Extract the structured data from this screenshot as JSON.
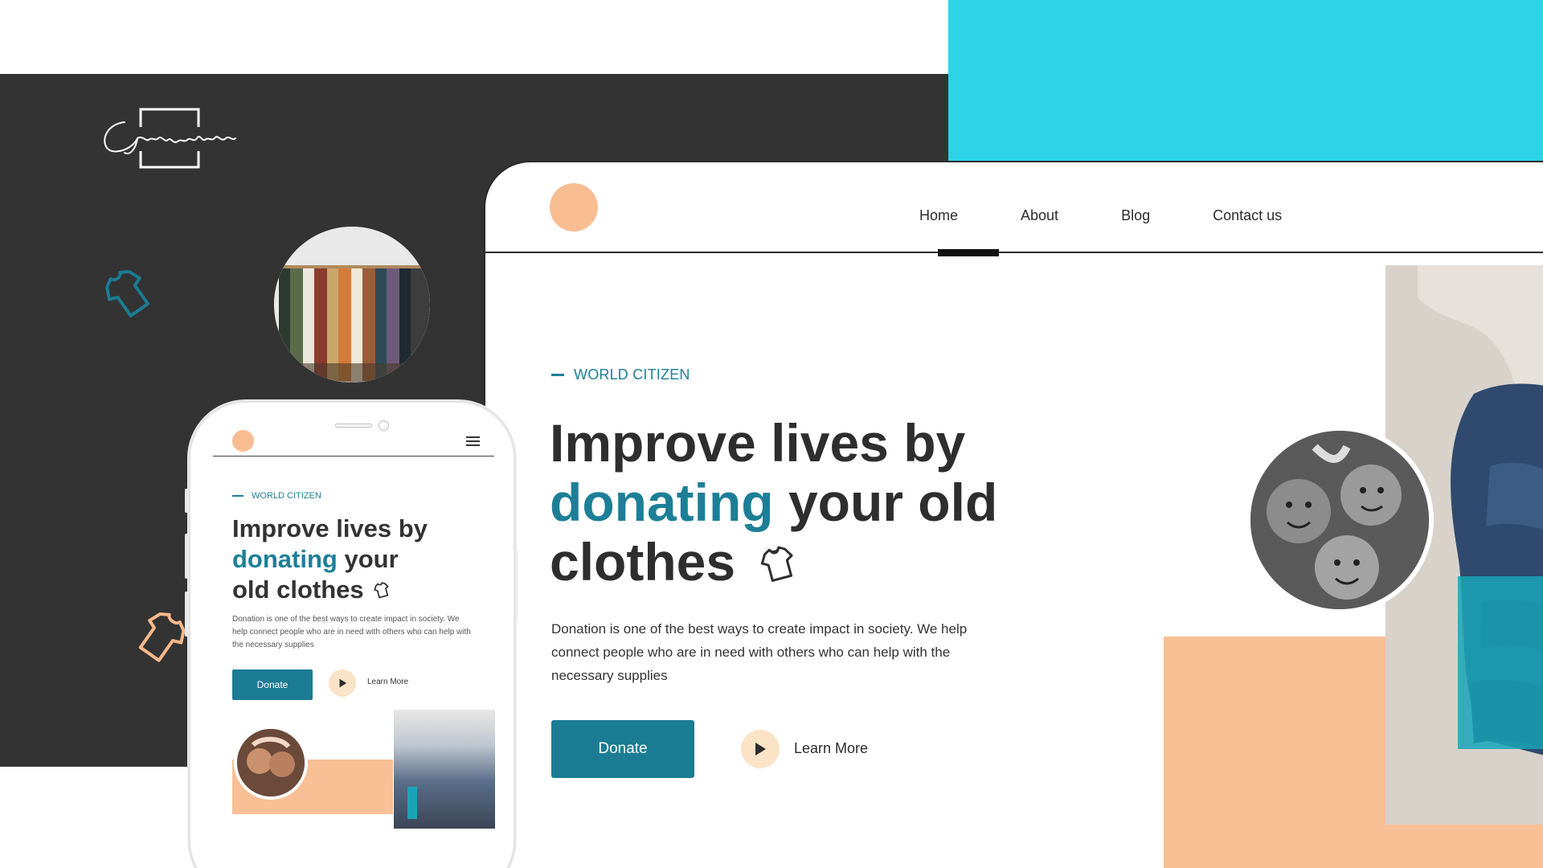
{
  "brand": {
    "signature_text": "Georgeseech",
    "colors": {
      "dark": "#333333",
      "cyan": "#2dd3e6",
      "peach": "#f9c096",
      "teal": "#1b7c93",
      "cream": "#fbe3c7"
    }
  },
  "decor": {
    "shirt_icon_1": "tshirt-outline-icon",
    "shirt_icon_2": "tshirt-outline-icon",
    "clothes_rack_photo": "clothes-rack-image"
  },
  "desktop": {
    "nav": {
      "items": [
        {
          "label": "Home",
          "active": true
        },
        {
          "label": "About",
          "active": false
        },
        {
          "label": "Blog",
          "active": false
        },
        {
          "label": "Contact us",
          "active": false
        }
      ]
    },
    "hero": {
      "eyebrow": "WORLD CITIZEN",
      "headline_part1": "Improve lives by",
      "headline_accent": "donating",
      "headline_part2": "your old",
      "headline_part3": "clothes",
      "description": "Donation is one of the best ways to create impact in society. We help connect people who are in need with others who can help with the necessary supplies",
      "donate_label": "Donate",
      "learn_more_label": "Learn More"
    },
    "images": {
      "kids_photo": "children-photo",
      "knit_photo": "knit-sweater-jeans-image"
    }
  },
  "mobile": {
    "hero": {
      "eyebrow": "WORLD CITIZEN",
      "headline_part1": "Improve lives by",
      "headline_accent": "donating",
      "headline_part2": "your",
      "headline_part3": "old clothes",
      "description": "Donation is one of the best ways to create impact in society. We help connect people who are in need with others who can help with the necessary supplies",
      "donate_label": "Donate",
      "learn_more_label": "Learn More"
    }
  }
}
